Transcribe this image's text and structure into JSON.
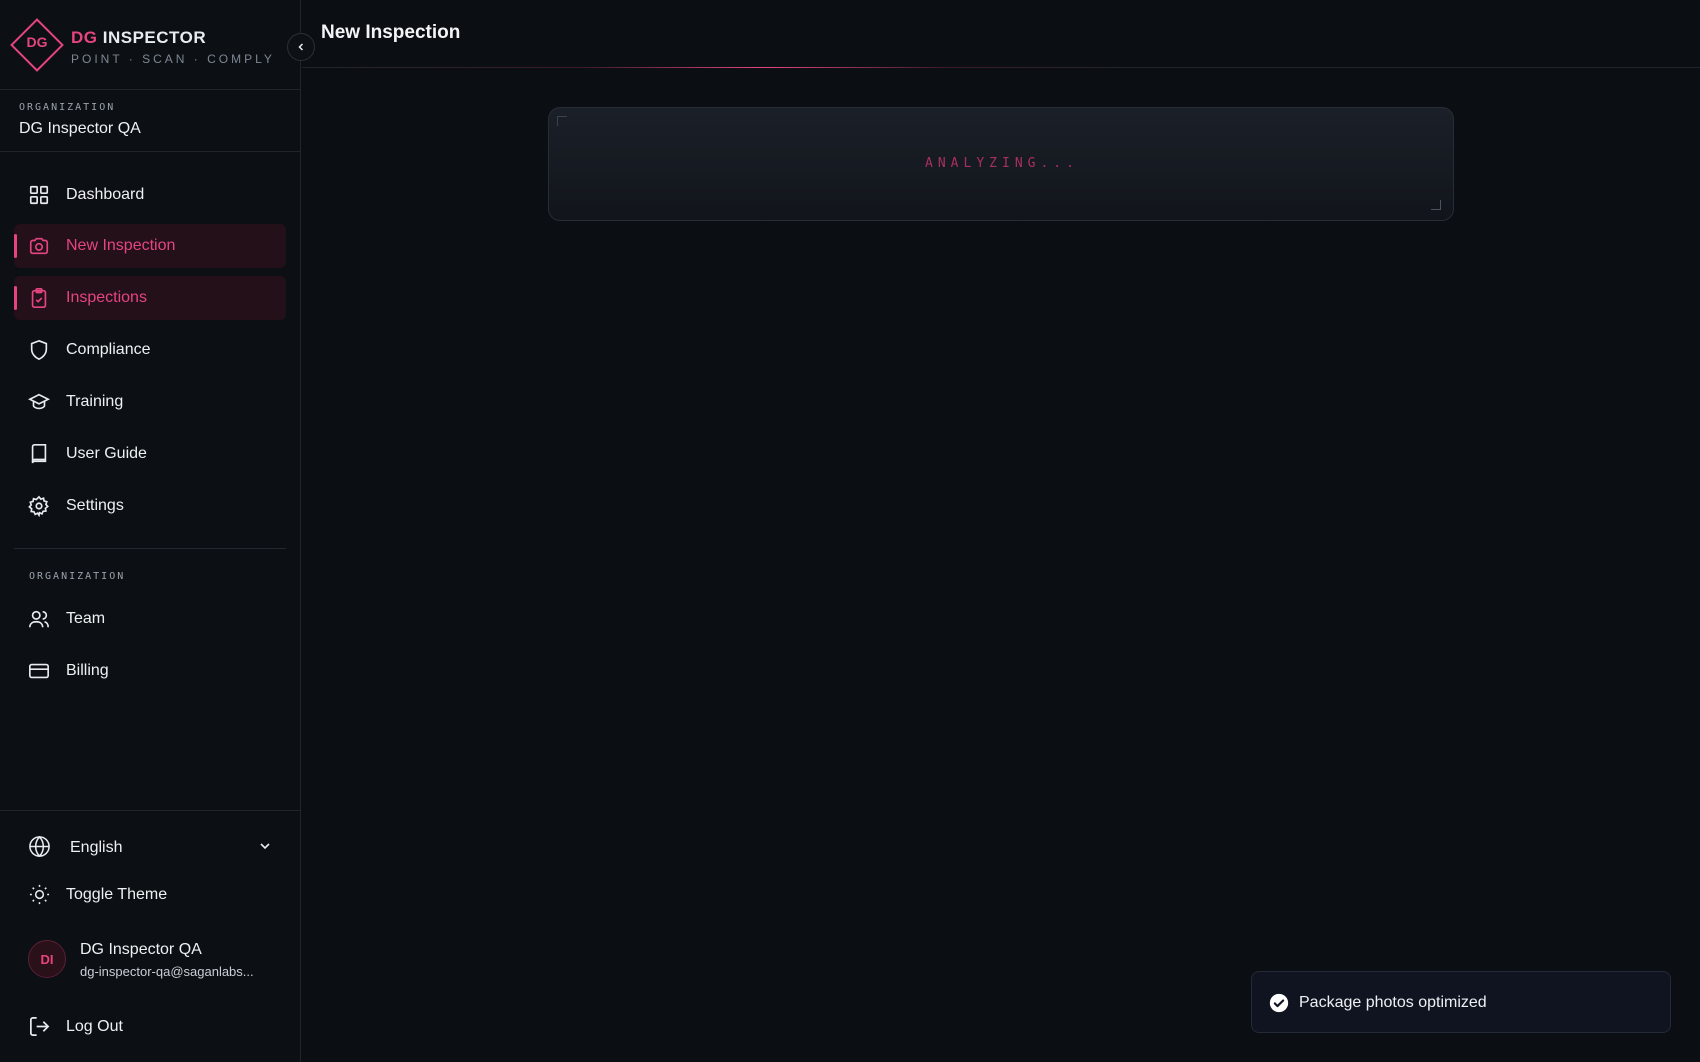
{
  "brand": {
    "logo_text": "DG",
    "title_accent": "DG",
    "title_rest": "INSPECTOR",
    "tagline": "POINT · SCAN · COMPLY"
  },
  "organization": {
    "label": "ORGANIZATION",
    "name": "DG Inspector QA"
  },
  "nav": {
    "items": [
      {
        "label": "Dashboard",
        "icon": "grid-icon",
        "active": false
      },
      {
        "label": "New Inspection",
        "icon": "camera-icon",
        "active": true
      },
      {
        "label": "Inspections",
        "icon": "clipboard-check-icon",
        "active": true
      },
      {
        "label": "Compliance",
        "icon": "shield-icon",
        "active": false
      },
      {
        "label": "Training",
        "icon": "graduation-cap-icon",
        "active": false
      },
      {
        "label": "User Guide",
        "icon": "book-icon",
        "active": false
      },
      {
        "label": "Settings",
        "icon": "gear-icon",
        "active": false
      }
    ],
    "org_section_label": "ORGANIZATION",
    "org_items": [
      {
        "label": "Team",
        "icon": "users-icon"
      },
      {
        "label": "Billing",
        "icon": "credit-card-icon"
      }
    ]
  },
  "footer": {
    "language": "English",
    "toggle_theme": "Toggle Theme",
    "user": {
      "initials": "DI",
      "name": "DG Inspector QA",
      "email": "dg-inspector-qa@saganlabs..."
    },
    "logout": "Log Out"
  },
  "main": {
    "title": "New Inspection",
    "status_text": "ANALYZING..."
  },
  "toast": {
    "message": "Package photos optimized"
  },
  "colors": {
    "accent": "#e5457f",
    "background": "#0b0e12"
  }
}
